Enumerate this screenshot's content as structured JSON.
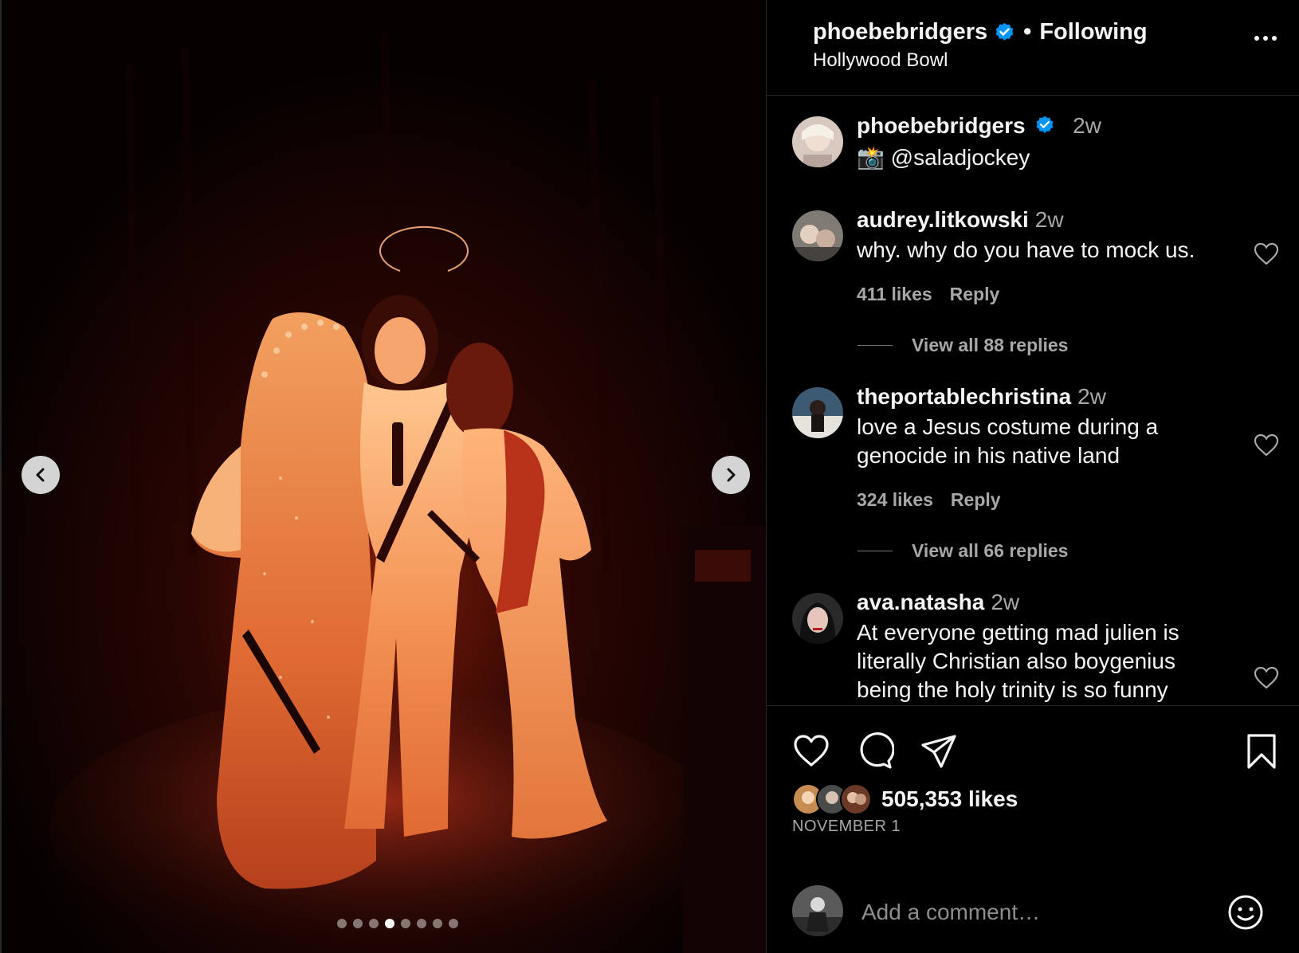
{
  "post": {
    "username": "phoebebridgers",
    "separator": "•",
    "follow_status": "Following",
    "location": "Hollywood Bowl",
    "caption": {
      "username": "phoebebridgers",
      "time": "2w",
      "camera_emoji": "📸",
      "text": "@saladjockey"
    },
    "carousel": {
      "total": 8,
      "active_index": 3
    }
  },
  "comments": [
    {
      "username": "audrey.litkowski",
      "time": "2w",
      "text": "why. why do you have to mock us.",
      "likes": "411 likes",
      "reply_label": "Reply",
      "view_replies": "View all 88 replies"
    },
    {
      "username": "theportablechristina",
      "time": "2w",
      "text": "love a Jesus costume during a genocide in his native land",
      "likes": "324 likes",
      "reply_label": "Reply",
      "view_replies": "View all 66 replies"
    },
    {
      "username": "ava.natasha",
      "time": "2w",
      "text": "At everyone getting mad julien is literally Christian also boygenius being the holy trinity is so funny"
    }
  ],
  "footer": {
    "likes": "505,353 likes",
    "date": "NOVEMBER 1",
    "comment_placeholder": "Add a comment…"
  },
  "colors": {
    "background": "#000000",
    "text": "#f5f5f5",
    "muted": "#a8a8a8",
    "verified": "#0095f6",
    "divider": "#262626"
  },
  "icons": [
    "chevron-left-icon",
    "chevron-right-icon",
    "verified-badge-icon",
    "more-options-icon",
    "heart-icon",
    "comment-icon",
    "share-icon",
    "bookmark-icon",
    "emoji-icon"
  ]
}
